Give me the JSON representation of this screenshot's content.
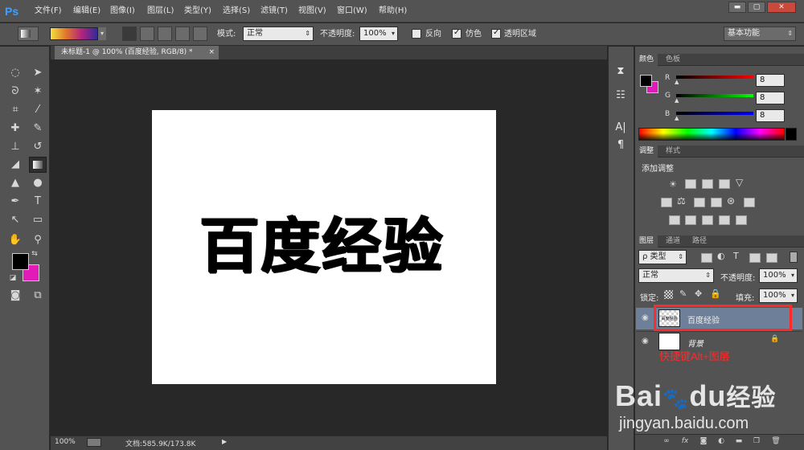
{
  "app": {
    "logo": "Ps"
  },
  "menu": [
    "文件(F)",
    "编辑(E)",
    "图像(I)",
    "图层(L)",
    "类型(Y)",
    "选择(S)",
    "滤镜(T)",
    "视图(V)",
    "窗口(W)",
    "帮助(H)"
  ],
  "window": {
    "minimize": "▬",
    "restore": "▢",
    "close": "✕"
  },
  "options": {
    "mode_label": "模式:",
    "mode_value": "正常",
    "opacity_label": "不透明度:",
    "opacity_value": "100%",
    "reverse_label": "反向",
    "dither_label": "仿色",
    "transparency_label": "透明区域",
    "workspace_value": "基本功能",
    "gradient_colors": [
      "#f5e142",
      "#e0752a",
      "#b2237f",
      "#2e2b9a"
    ]
  },
  "document": {
    "tab_title": "未标题-1 @ 100% (百度经验, RGB/8) *",
    "tab_close": "×",
    "canvas_text": "百度经验"
  },
  "status": {
    "zoom": "100%",
    "doc_info": "文档:585.9K/173.8K"
  },
  "panels": {
    "color_tabs": [
      "颜色",
      "色板"
    ],
    "r_label": "R",
    "g_label": "G",
    "b_label": "B",
    "r_value": "8",
    "g_value": "8",
    "b_value": "8",
    "adjust_tabs": [
      "调整",
      "样式"
    ],
    "add_adjustment": "添加调整",
    "layer_tabs": [
      "图层",
      "通道",
      "路径"
    ],
    "kind_label": "ρ 类型",
    "blend_mode": "正常",
    "layer_opacity_label": "不透明度:",
    "layer_opacity_value": "100%",
    "lock_label": "锁定:",
    "fill_label": "填充:",
    "fill_value": "100%",
    "layers": [
      {
        "name": "百度经验",
        "thumb": "百度经验"
      },
      {
        "name": "背景"
      }
    ],
    "annotation": "快捷键Alt+图层"
  },
  "colors": {
    "foreground": "#000000",
    "background": "#e21bb8",
    "highlight": "#ff2a2a",
    "selected_layer": "#6d7f99"
  },
  "watermark": {
    "brand": "Bai",
    "brand2": "du",
    "brand_cn": "经验",
    "url": "jingyan.baidu.com"
  }
}
